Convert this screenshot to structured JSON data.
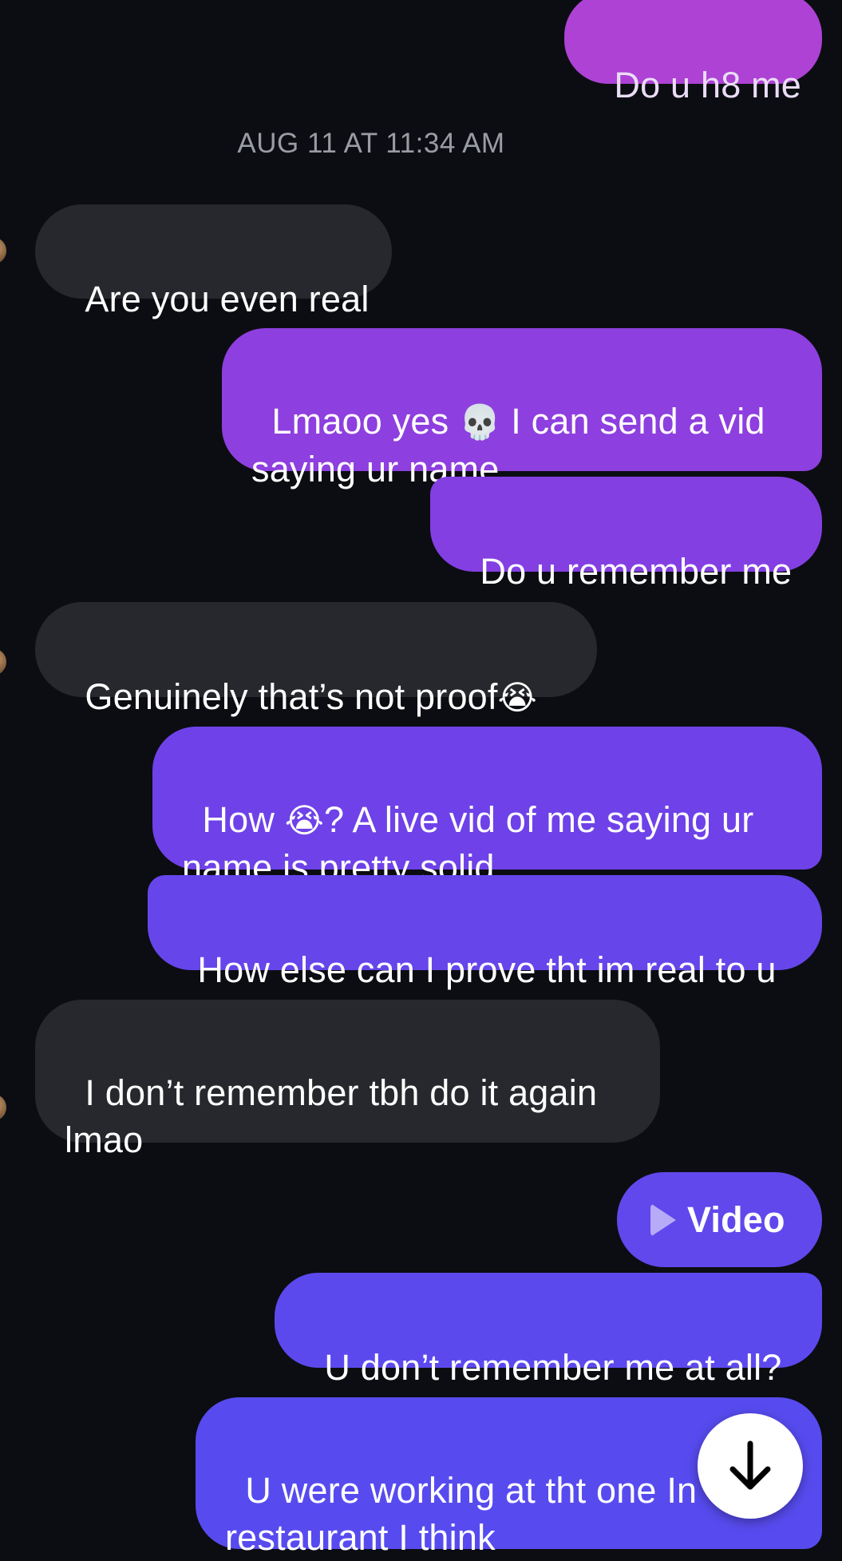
{
  "timestamp": "AUG 11 AT 11:34 AM",
  "messages": [
    {
      "id": "m0",
      "direction": "out",
      "text": "Do u h8 me"
    },
    {
      "id": "m1",
      "direction": "in",
      "text": "Are you even real"
    },
    {
      "id": "m2",
      "direction": "out",
      "text_before": "Lmaoo yes ",
      "emoji": "💀",
      "text_after": " I can send a vid\nsaying ur name"
    },
    {
      "id": "m3",
      "direction": "out",
      "text": "Do u remember me"
    },
    {
      "id": "m4",
      "direction": "in",
      "text_before": "Genuinely that’s not proof",
      "emoji": "😭"
    },
    {
      "id": "m5",
      "direction": "out",
      "text_before": "How ",
      "emoji": "😭",
      "text_after": "? A live vid of me saying ur\nname is pretty solid"
    },
    {
      "id": "m6",
      "direction": "out",
      "text": "How else can I prove tht im real to u"
    },
    {
      "id": "m7",
      "direction": "in",
      "text": "I don’t remember tbh do it again\nlmao"
    },
    {
      "id": "m8",
      "direction": "out",
      "type": "video",
      "label": "Video"
    },
    {
      "id": "m9",
      "direction": "out",
      "text": "U don’t remember me at all?"
    },
    {
      "id": "m10",
      "direction": "out",
      "text": "U were working at tht one In\nrestaurant I think"
    }
  ],
  "icons": {
    "play": "play-icon",
    "scroll_down": "arrow-down-icon",
    "avatar": "avatar"
  },
  "colors": {
    "background": "#0c0d12",
    "incoming_bubble": "#26282d",
    "outgoing_gradient_top": "#a63fd3",
    "outgoing_gradient_bottom": "#5b4bea",
    "timestamp": "#9a9ca3"
  }
}
